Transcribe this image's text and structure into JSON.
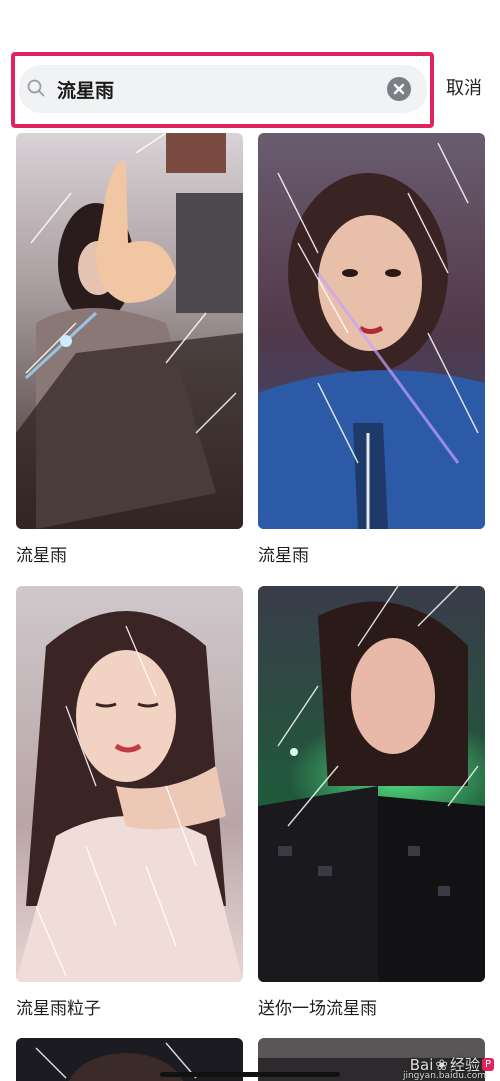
{
  "search": {
    "value": "流星雨",
    "cancel_label": "取消"
  },
  "results": [
    {
      "title": "流星雨"
    },
    {
      "title": "流星雨"
    },
    {
      "title": "流星雨粒子"
    },
    {
      "title": "送你一场流星雨"
    }
  ],
  "watermark": {
    "brand": "Bai",
    "brand2": "经验",
    "badge": "P",
    "sub": "jingyan.baidu.com"
  },
  "icons": [
    "search-icon",
    "clear-icon"
  ],
  "colors": {
    "highlight": "#e0245e",
    "search_bg": "#f1f2f4"
  }
}
